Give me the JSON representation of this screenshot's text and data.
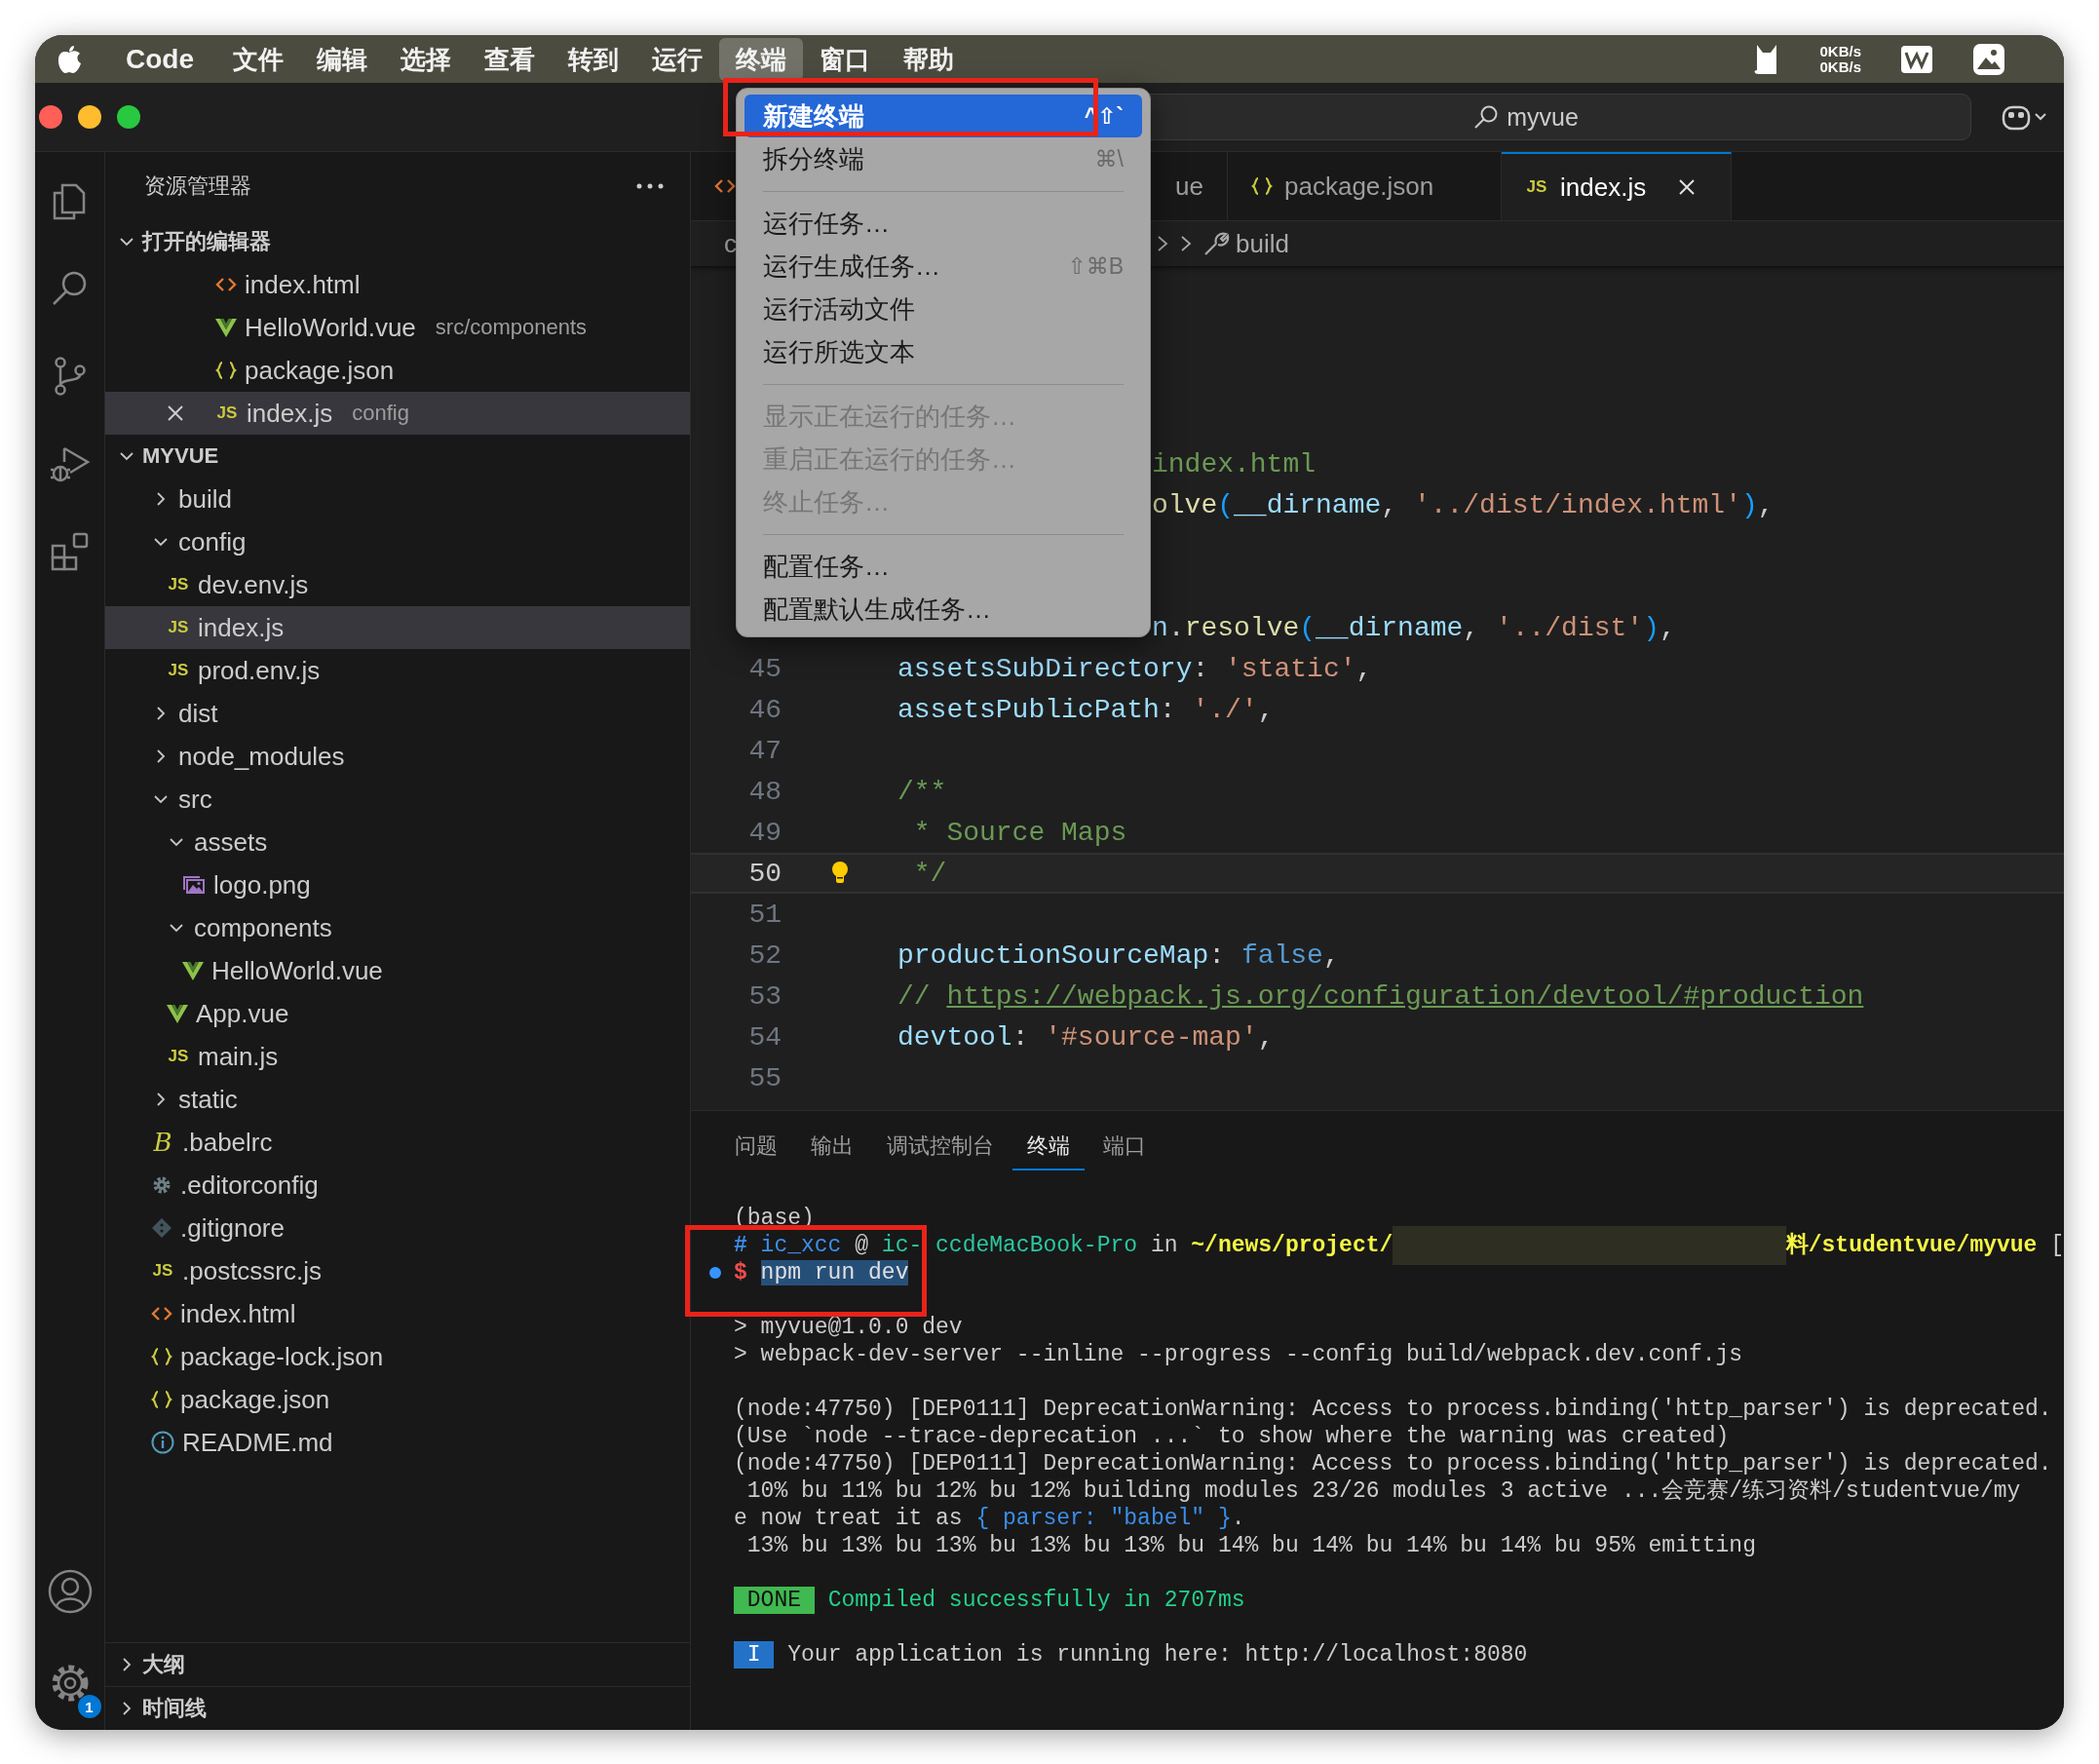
{
  "menu_bar": {
    "items": [
      {
        "label": "Code",
        "kind": "app",
        "selected": false
      },
      {
        "label": "文件",
        "kind": "menu",
        "selected": false
      },
      {
        "label": "编辑",
        "kind": "menu",
        "selected": false
      },
      {
        "label": "选择",
        "kind": "menu",
        "selected": false
      },
      {
        "label": "查看",
        "kind": "menu",
        "selected": false
      },
      {
        "label": "转到",
        "kind": "menu",
        "selected": false
      },
      {
        "label": "运行",
        "kind": "menu",
        "selected": false
      },
      {
        "label": "终端",
        "kind": "menu",
        "selected": true
      },
      {
        "label": "窗口",
        "kind": "menu",
        "selected": false
      },
      {
        "label": "帮助",
        "kind": "menu",
        "selected": false
      }
    ],
    "network_speed": [
      "0KB/s",
      "0KB/s"
    ]
  },
  "title_bar": {
    "title": "myvue"
  },
  "activity_bar": {
    "settings_badge": "1"
  },
  "sidebar": {
    "title": "资源管理器",
    "open_editors": {
      "title": "打开的编辑器",
      "expanded": true,
      "items": [
        {
          "name": "index.html",
          "kind": "html",
          "selected": false
        },
        {
          "name": "HelloWorld.vue",
          "kind": "vue",
          "description": "src/components",
          "selected": false
        },
        {
          "name": "package.json",
          "kind": "json",
          "selected": false
        },
        {
          "name": "index.js",
          "kind": "js",
          "icon_text": "JS",
          "description": "config",
          "selected": true
        }
      ]
    },
    "project": {
      "title": "MYVUE",
      "expanded": true,
      "items": [
        {
          "name": "build",
          "kind": "folder",
          "expanded": false,
          "selected": false
        },
        {
          "name": "config",
          "kind": "folder",
          "expanded": true,
          "selected": false,
          "children": [
            {
              "name": "dev.env.js",
              "kind": "js",
              "icon_text": "JS",
              "selected": false
            },
            {
              "name": "index.js",
              "kind": "js",
              "icon_text": "JS",
              "selected": true
            },
            {
              "name": "prod.env.js",
              "kind": "js",
              "icon_text": "JS",
              "selected": false
            }
          ]
        },
        {
          "name": "dist",
          "kind": "folder",
          "expanded": false,
          "selected": false
        },
        {
          "name": "node_modules",
          "kind": "folder",
          "expanded": false,
          "selected": false
        },
        {
          "name": "src",
          "kind": "folder",
          "expanded": true,
          "selected": false,
          "children": [
            {
              "name": "assets",
              "kind": "folder",
              "expanded": true,
              "selected": false,
              "children": [
                {
                  "name": "logo.png",
                  "kind": "image",
                  "selected": false
                }
              ]
            },
            {
              "name": "components",
              "kind": "folder",
              "expanded": true,
              "selected": false,
              "children": [
                {
                  "name": "HelloWorld.vue",
                  "kind": "vue",
                  "selected": false
                }
              ]
            },
            {
              "name": "App.vue",
              "kind": "vue",
              "selected": false
            },
            {
              "name": "main.js",
              "kind": "js",
              "icon_text": "JS",
              "selected": false
            }
          ]
        },
        {
          "name": "static",
          "kind": "folder",
          "expanded": false,
          "selected": false
        },
        {
          "name": ".babelrc",
          "kind": "babel",
          "icon_text": "B",
          "selected": false
        },
        {
          "name": ".editorconfig",
          "kind": "gear",
          "selected": false
        },
        {
          "name": ".gitignore",
          "kind": "git",
          "selected": false
        },
        {
          "name": ".postcssrc.js",
          "kind": "js",
          "icon_text": "JS",
          "selected": false
        },
        {
          "name": "index.html",
          "kind": "html",
          "selected": false
        },
        {
          "name": "package-lock.json",
          "kind": "json",
          "selected": false
        },
        {
          "name": "package.json",
          "kind": "json",
          "selected": false
        },
        {
          "name": "README.md",
          "kind": "info",
          "selected": false
        }
      ]
    },
    "footer_sections": [
      {
        "title": "大纲",
        "expanded": false
      },
      {
        "title": "时间线",
        "expanded": false
      }
    ]
  },
  "editor": {
    "tabs": [
      {
        "kind": "html",
        "selected": false
      },
      {
        "label": "ue",
        "selected": false
      },
      {
        "label": "package.json",
        "kind": "json",
        "selected": false
      },
      {
        "label": "index.js",
        "kind": "js",
        "icon_text": "JS",
        "selected": true
      }
    ],
    "breadcrumb": [
      {
        "label": "c",
        "kind": "folder"
      },
      {
        "label": "build",
        "kind": "property"
      }
    ],
    "lines": [
      {
        "kind": "clipped",
        "tokens": [
          {
            "t": "index.html",
            "kind": "cmt"
          }
        ]
      },
      {
        "kind": "clipped",
        "tokens": [
          {
            "t": "olve",
            "kind": "fn"
          },
          {
            "t": "(",
            "kind": "paren"
          },
          {
            "t": "__dirname",
            "kind": "var"
          },
          {
            "t": ", ",
            "kind": "punc"
          },
          {
            "t": "'../dist/index.html'",
            "kind": "str"
          },
          {
            "t": ")",
            "kind": "paren"
          },
          {
            "t": ",",
            "kind": "punc"
          }
        ]
      },
      {
        "kind": "blank"
      },
      {
        "kind": "blank"
      },
      {
        "kind": "clipped",
        "tokens": [
          {
            "t": "n",
            "kind": "var"
          },
          {
            "t": ".",
            "kind": "punc"
          },
          {
            "t": "resolve",
            "kind": "fn"
          },
          {
            "t": "(",
            "kind": "paren"
          },
          {
            "t": "__dirname",
            "kind": "var"
          },
          {
            "t": ", ",
            "kind": "punc"
          },
          {
            "t": "'../dist'",
            "kind": "str"
          },
          {
            "t": ")",
            "kind": "paren"
          },
          {
            "t": ",",
            "kind": "punc"
          }
        ]
      },
      {
        "kind": "code",
        "number": "45",
        "current": false,
        "tokens": [
          {
            "t": "assetsSubDirectory",
            "kind": "key"
          },
          {
            "t": ": ",
            "kind": "punc"
          },
          {
            "t": "'static'",
            "kind": "str"
          },
          {
            "t": ",",
            "kind": "punc"
          }
        ]
      },
      {
        "kind": "code",
        "number": "46",
        "current": false,
        "tokens": [
          {
            "t": "assetsPublicPath",
            "kind": "key"
          },
          {
            "t": ": ",
            "kind": "punc"
          },
          {
            "t": "'./'",
            "kind": "str"
          },
          {
            "t": ",",
            "kind": "punc"
          }
        ]
      },
      {
        "kind": "code",
        "number": "47",
        "current": false
      },
      {
        "kind": "code",
        "number": "48",
        "current": false,
        "tokens": [
          {
            "t": "/**",
            "kind": "cmt"
          }
        ]
      },
      {
        "kind": "code",
        "number": "49",
        "current": false,
        "tokens": [
          {
            "t": " * Source Maps",
            "kind": "cmt"
          }
        ]
      },
      {
        "kind": "code",
        "number": "50",
        "current": true,
        "tokens": [
          {
            "t": " */",
            "kind": "cmt"
          }
        ]
      },
      {
        "kind": "code",
        "number": "51",
        "current": false
      },
      {
        "kind": "code",
        "number": "52",
        "current": false,
        "tokens": [
          {
            "t": "productionSourceMap",
            "kind": "key"
          },
          {
            "t": ": ",
            "kind": "punc"
          },
          {
            "t": "false",
            "kind": "kw"
          },
          {
            "t": ",",
            "kind": "punc"
          }
        ]
      },
      {
        "kind": "code",
        "number": "53",
        "current": false,
        "tokens": [
          {
            "t": "// ",
            "kind": "cmt"
          },
          {
            "t": "https://webpack.js.org/configuration/devtool/#production",
            "kind": "link"
          }
        ]
      },
      {
        "kind": "code",
        "number": "54",
        "current": false,
        "tokens": [
          {
            "t": "devtool",
            "kind": "key"
          },
          {
            "t": ": ",
            "kind": "punc"
          },
          {
            "t": "'#source-map'",
            "kind": "str"
          },
          {
            "t": ",",
            "kind": "punc"
          }
        ]
      },
      {
        "kind": "code",
        "number": "55",
        "current": false
      }
    ]
  },
  "panel": {
    "tabs": [
      {
        "label": "问题",
        "selected": false
      },
      {
        "label": "输出",
        "selected": false
      },
      {
        "label": "调试控制台",
        "selected": false
      },
      {
        "label": "终端",
        "selected": true
      },
      {
        "label": "端口",
        "selected": false
      }
    ],
    "terminal_lines": [
      {
        "kind": "text",
        "segments": [
          {
            "t": "(base)",
            "kind": "plain"
          }
        ]
      },
      {
        "kind": "text",
        "segments": [
          {
            "t": "# ",
            "kind": "hash"
          },
          {
            "t": "ic_xcc",
            "kind": "user"
          },
          {
            "t": " @ ",
            "kind": "plain"
          },
          {
            "t": "ic-",
            "kind": "host"
          },
          {
            "kind": "covered"
          },
          {
            "t": "ccdeMacBook-Pro",
            "kind": "host"
          },
          {
            "t": " in ",
            "kind": "plain"
          },
          {
            "t": "~/news/project/",
            "kind": "path"
          },
          {
            "kind": "redacted"
          },
          {
            "t": "料/studentvue/myvue",
            "kind": "path"
          },
          {
            "t": " [",
            "kind": "plain"
          }
        ]
      },
      {
        "kind": "command",
        "segments": [
          {
            "t": "$ ",
            "kind": "dollar"
          },
          {
            "t": "npm run dev",
            "kind": "selected"
          }
        ]
      },
      {
        "kind": "blank"
      },
      {
        "kind": "text",
        "segments": [
          {
            "t": "> myvue@1.0.0 dev",
            "kind": "plain"
          }
        ]
      },
      {
        "kind": "text",
        "segments": [
          {
            "t": "> webpack-dev-server --inline --progress --config build/webpack.dev.conf.js",
            "kind": "plain"
          }
        ]
      },
      {
        "kind": "blank"
      },
      {
        "kind": "text",
        "segments": [
          {
            "t": "(node:47750) [DEP0111] DeprecationWarning: Access to process.binding('http_parser') is deprecated.",
            "kind": "plain"
          }
        ]
      },
      {
        "kind": "text",
        "segments": [
          {
            "t": "(Use `node --trace-deprecation ...` to show where the warning was created)",
            "kind": "plain"
          }
        ]
      },
      {
        "kind": "text",
        "segments": [
          {
            "t": "(node:47750) [DEP0111] DeprecationWarning: Access to process.binding('http_parser') is deprecated.",
            "kind": "plain"
          }
        ]
      },
      {
        "kind": "text",
        "segments": [
          {
            "t": " 10% bu 11% bu 12% bu 12% building modules 23/26 modules 3 active ...会竞赛/练习资料/studentvue/my",
            "kind": "plain"
          }
        ]
      },
      {
        "kind": "text",
        "segments": [
          {
            "t": "e now treat it as ",
            "kind": "plain"
          },
          {
            "t": "{ parser: \"babel\" }",
            "kind": "blue"
          },
          {
            "t": ".",
            "kind": "plain"
          }
        ]
      },
      {
        "kind": "text",
        "segments": [
          {
            "t": " 13% bu 13% bu 13% bu 13% bu 13% bu 14% bu 14% bu 14% bu 14% bu 95% emitting",
            "kind": "plain"
          }
        ]
      },
      {
        "kind": "blank"
      },
      {
        "kind": "text",
        "segments": [
          {
            "t": " DONE ",
            "kind": "badge-done"
          },
          {
            "t": " Compiled successfully in 2707ms",
            "kind": "green"
          }
        ]
      },
      {
        "kind": "blank"
      },
      {
        "kind": "text",
        "segments": [
          {
            "t": " I ",
            "kind": "badge-info"
          },
          {
            "t": " Your application is running here: http://localhost:8080",
            "kind": "plain"
          }
        ]
      }
    ]
  },
  "terminal_menu": {
    "items": [
      {
        "kind": "item",
        "label": "新建终端",
        "shortcut": "^⇧`",
        "selected": true,
        "disabled": false
      },
      {
        "kind": "item",
        "label": "拆分终端",
        "shortcut": "⌘\\",
        "selected": false,
        "disabled": false
      },
      {
        "kind": "separator"
      },
      {
        "kind": "item",
        "label": "运行任务…",
        "selected": false,
        "disabled": false
      },
      {
        "kind": "item",
        "label": "运行生成任务…",
        "shortcut": "⇧⌘B",
        "selected": false,
        "disabled": false
      },
      {
        "kind": "item",
        "label": "运行活动文件",
        "selected": false,
        "disabled": false
      },
      {
        "kind": "item",
        "label": "运行所选文本",
        "selected": false,
        "disabled": false
      },
      {
        "kind": "separator"
      },
      {
        "kind": "item",
        "label": "显示正在运行的任务…",
        "selected": false,
        "disabled": true
      },
      {
        "kind": "item",
        "label": "重启正在运行的任务…",
        "selected": false,
        "disabled": true
      },
      {
        "kind": "item",
        "label": "终止任务…",
        "selected": false,
        "disabled": true
      },
      {
        "kind": "separator"
      },
      {
        "kind": "item",
        "label": "配置任务…",
        "selected": false,
        "disabled": false
      },
      {
        "kind": "item",
        "label": "配置默认生成任务…",
        "selected": false,
        "disabled": false
      }
    ]
  },
  "annotations": [
    {
      "kind": "frame"
    },
    {
      "kind": "frame"
    }
  ]
}
